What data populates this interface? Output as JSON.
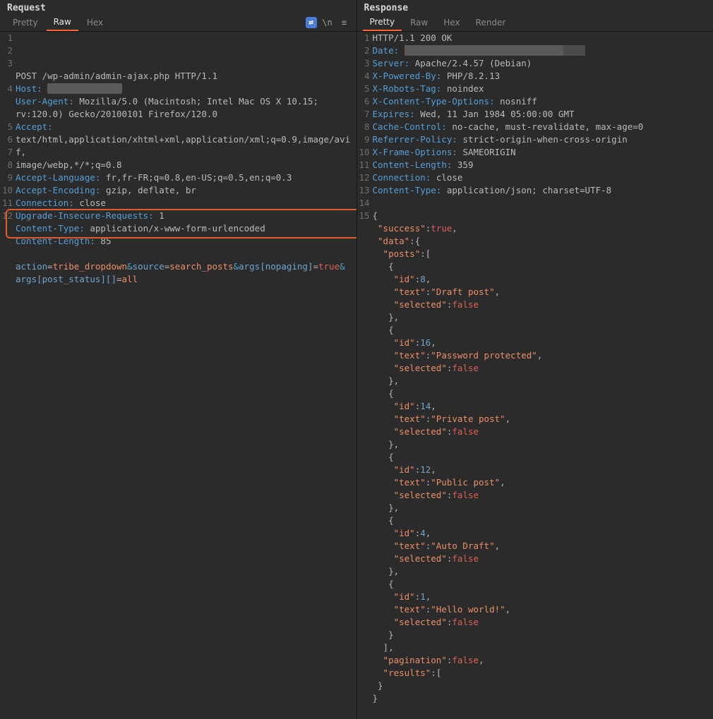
{
  "request": {
    "title": "Request",
    "tabs": {
      "pretty": "Pretty",
      "raw": "Raw",
      "hex": "Hex",
      "active": "Raw"
    },
    "icons": {
      "newline": "\\n",
      "menu": "≡",
      "format": "⇄"
    },
    "line1": {
      "method": "POST",
      "path": "/wp-admin/admin-ajax.php",
      "proto": "HTTP/1.1"
    },
    "headers": {
      "Host": {
        "key": "Host:",
        "value": "              "
      },
      "UserAgent": {
        "key": "User-Agent:",
        "value": "Mozilla/5.0 (Macintosh; Intel Mac OS X 10.15; rv:120.0) Gecko/20100101 Firefox/120.0"
      },
      "Accept": {
        "key": "Accept:",
        "value": "text/html,application/xhtml+xml,application/xml;q=0.9,image/avif,image/webp,*/*;q=0.8"
      },
      "AcceptLanguage": {
        "key": "Accept-Language:",
        "value": "fr,fr-FR;q=0.8,en-US;q=0.5,en;q=0.3"
      },
      "AcceptEncoding": {
        "key": "Accept-Encoding:",
        "value": "gzip, deflate, br"
      },
      "Connection": {
        "key": "Connection:",
        "value": "close"
      },
      "UIR": {
        "key": "Upgrade-Insecure-Requests:",
        "value": "1"
      },
      "ContentType": {
        "key": "Content-Type:",
        "value": "application/x-www-form-urlencoded"
      },
      "ContentLength": {
        "key": "Content-Length:",
        "value": "85"
      }
    },
    "body": {
      "p1": {
        "k": "action",
        "eq": "=",
        "v": "tribe_dropdown"
      },
      "amp": "&",
      "p2": {
        "k": "source",
        "eq": "=",
        "v": "search_posts"
      },
      "p3": {
        "k": "args[nopaging]",
        "eq": "=",
        "v": "true"
      },
      "p4": {
        "k": "args[post_status][]",
        "eq": "=",
        "v": "all"
      }
    }
  },
  "response": {
    "title": "Response",
    "tabs": {
      "pretty": "Pretty",
      "raw": "Raw",
      "hex": "Hex",
      "render": "Render",
      "active": "Pretty"
    },
    "status": "HTTP/1.1 200 OK",
    "headers": {
      "Date": {
        "key": "Date:",
        "value": "                              "
      },
      "Server": {
        "key": "Server:",
        "value": "Apache/2.4.57 (Debian)"
      },
      "XPoweredBy": {
        "key": "X-Powered-By:",
        "value": "PHP/8.2.13"
      },
      "XRobotsTag": {
        "key": "X-Robots-Tag:",
        "value": "noindex"
      },
      "XCTO": {
        "key": "X-Content-Type-Options:",
        "value": "nosniff"
      },
      "Expires": {
        "key": "Expires:",
        "value": "Wed, 11 Jan 1984 05:00:00 GMT"
      },
      "CacheControl": {
        "key": "Cache-Control:",
        "value": "no-cache, must-revalidate, max-age=0"
      },
      "ReferrerPolicy": {
        "key": "Referrer-Policy:",
        "value": "strict-origin-when-cross-origin"
      },
      "XFO": {
        "key": "X-Frame-Options:",
        "value": "SAMEORIGIN"
      },
      "ContentLength": {
        "key": "Content-Length:",
        "value": "359"
      },
      "Connection": {
        "key": "Connection:",
        "value": "close"
      },
      "ContentType": {
        "key": "Content-Type:",
        "value": "application/json; charset=UTF-8"
      }
    },
    "json": {
      "success_key": "\"success\"",
      "success_val": "true",
      "data_key": "\"data\"",
      "posts_key": "\"posts\"",
      "id_key": "\"id\"",
      "text_key": "\"text\"",
      "selected_key": "\"selected\"",
      "false": "false",
      "p1": {
        "id": "8",
        "text": "\"Draft post\""
      },
      "p2": {
        "id": "16",
        "text": "\"Password protected\""
      },
      "p3": {
        "id": "14",
        "text": "\"Private post\""
      },
      "p4": {
        "id": "12",
        "text": "\"Public post\""
      },
      "p5": {
        "id": "4",
        "text": "\"Auto Draft\""
      },
      "p6": {
        "id": "1",
        "text": "\"Hello world!\""
      },
      "pagination_key": "\"pagination\"",
      "results_key": "\"results\"",
      "ob": "{",
      "cb": "}",
      "obr": "[",
      "cbr": "]",
      "col": ":",
      "com": ","
    }
  }
}
